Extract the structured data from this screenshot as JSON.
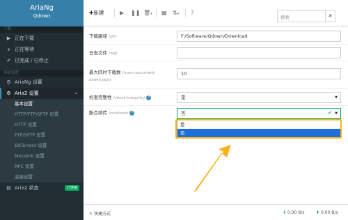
{
  "app": {
    "title": "AriaNg",
    "subtitle": "Qdown"
  },
  "sidebar": {
    "section_download": "下载",
    "downloads": [
      {
        "icon": "play-circle-icon",
        "label": "正在下载"
      },
      {
        "icon": "pause-circle-icon",
        "label": "正在等待"
      },
      {
        "icon": "check-circle-icon",
        "label": "已完成 / 已停止"
      }
    ],
    "section_settings": "系统设置",
    "ariang_settings": {
      "icon": "gear-icon",
      "label": "AriaNg 设置"
    },
    "aria2_settings": {
      "icon": "gears-icon",
      "label": "Aria2 设置"
    },
    "aria2_sub": [
      "基本设置",
      "HTTP/FTP/SFTP 设置",
      "HTTP 设置",
      "FTP/SFTP 设置",
      "BitTorrent 设置",
      "Metalink 设置",
      "RPC 设置",
      "高级设置"
    ],
    "aria2_status": {
      "icon": "server-icon",
      "label": "Aria2 状态",
      "badge": "已连接"
    }
  },
  "toolbar": {
    "new_label": "新建",
    "search_placeholder": "搜索"
  },
  "form": {
    "rows": [
      {
        "label": "下载路径",
        "hint": "(dir)",
        "value": "F:/Software/Qdown/Download"
      },
      {
        "label": "日志文件",
        "hint": "(log)",
        "value": ""
      },
      {
        "label": "最大同时下载数",
        "hint": "(max-concurrent-downloads)",
        "value": "10"
      },
      {
        "label": "检查完整性",
        "hint": "(check-integrity)",
        "value": "是"
      },
      {
        "label": "断点续传",
        "hint": "(continue)",
        "value": "否"
      }
    ],
    "dropdown_options": [
      "是",
      "否"
    ]
  },
  "footer": {
    "shortcut": "快捷方式",
    "download_speed": "0.00 B/s",
    "upload_speed": "0.00 B/s"
  },
  "colors": {
    "sidebar": "#222d32",
    "brand": "#367fa9",
    "accent": "#3c8dbc",
    "highlight": "#f6b318",
    "selected": "#1e6fd9",
    "connected": "#00a65a"
  }
}
